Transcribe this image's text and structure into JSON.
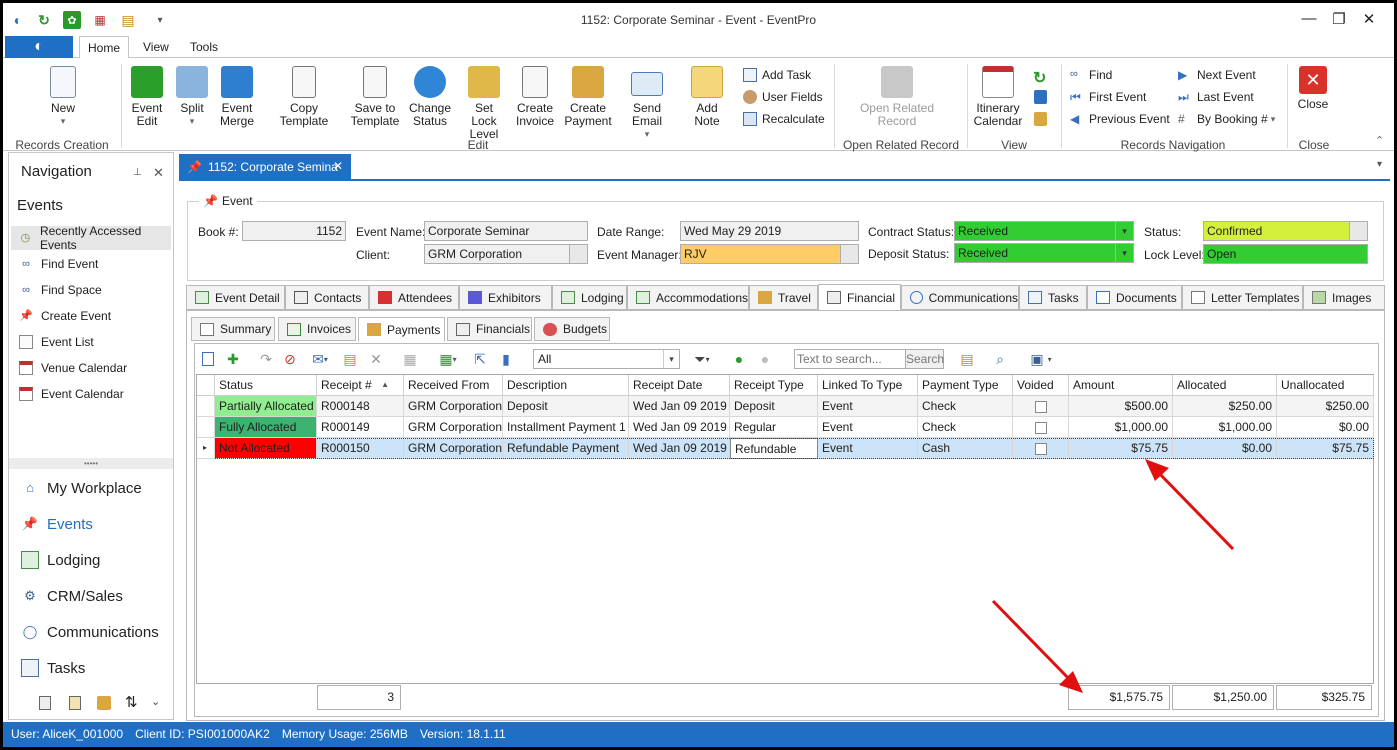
{
  "window": {
    "title": "1152: Corporate Seminar - Event - EventPro",
    "minimize": "—",
    "restore": "❐",
    "close": "✕"
  },
  "ribbon_tabs": [
    "Home",
    "View",
    "Tools"
  ],
  "ribbon": {
    "new": "New",
    "records_creation": "Records Creation",
    "event_edit": "Event\nEdit",
    "split": "Split",
    "event_merge": "Event\nMerge",
    "copy_template": "Copy Template",
    "save_to_template": "Save to\nTemplate",
    "change_status": "Change\nStatus",
    "set_lock_level": "Set Lock\nLevel",
    "create_invoice": "Create\nInvoice",
    "create_payment": "Create\nPayment",
    "send_email": "Send Email",
    "add_note": "Add Note",
    "add_task": "Add Task",
    "user_fields": "User Fields",
    "recalculate": "Recalculate",
    "edit_group": "Edit",
    "open_related_record": "Open Related\nRecord",
    "open_related_group": "Open Related Record",
    "itinerary_calendar": "Itinerary\nCalendar",
    "view_group": "View",
    "find": "Find",
    "first_event": "First Event",
    "previous_event": "Previous Event",
    "next_event": "Next Event",
    "last_event": "Last Event",
    "by_booking": "By Booking #",
    "records_nav_group": "Records Navigation",
    "close": "Close",
    "close_group": "Close"
  },
  "nav": {
    "title": "Navigation",
    "section": "Events",
    "items": [
      "Recently Accessed Events",
      "Find Event",
      "Find Space",
      "Create Event",
      "Event List",
      "Venue Calendar",
      "Event Calendar"
    ],
    "modules": [
      "My Workplace",
      "Events",
      "Lodging",
      "CRM/Sales",
      "Communications",
      "Tasks"
    ],
    "grip": "•••••"
  },
  "doc_tab": "1152: Corporate Semina",
  "event": {
    "header": "Event",
    "book_label": "Book #:",
    "book_value": "1152",
    "name_label": "Event Name:",
    "name_value": "Corporate Seminar",
    "client_label": "Client:",
    "client_value": "GRM Corporation",
    "date_label": "Date Range:",
    "date_value": "Wed May 29 2019",
    "manager_label": "Event Manager:",
    "manager_value": "RJV",
    "contract_label": "Contract Status:",
    "contract_value": "Received",
    "deposit_label": "Deposit Status:",
    "deposit_value": "Received",
    "status_label": "Status:",
    "status_value": "Confirmed",
    "lock_label": "Lock Level:",
    "lock_value": "Open"
  },
  "tabs": [
    "Event Detail",
    "Contacts",
    "Attendees",
    "Exhibitors",
    "Lodging",
    "Accommodations",
    "Travel",
    "Financial",
    "Communications",
    "Tasks",
    "Documents",
    "Letter Templates",
    "Images"
  ],
  "subtabs": [
    "Summary",
    "Invoices",
    "Payments",
    "Financials",
    "Budgets"
  ],
  "toolbar": {
    "filter_value": "All",
    "search_placeholder": "Text to search...",
    "search_button": "Search"
  },
  "grid": {
    "columns": [
      "Status",
      "Receipt #",
      "Received From",
      "Description",
      "Receipt Date",
      "Receipt Type",
      "Linked To Type",
      "Payment Type",
      "Voided",
      "Amount",
      "Allocated",
      "Unallocated"
    ],
    "rows": [
      {
        "status": "Partially Allocated",
        "receipt": "R000148",
        "from": "GRM Corporation",
        "description": "Deposit",
        "date": "Wed Jan 09 2019",
        "type": "Deposit",
        "linked": "Event",
        "payment": "Check",
        "amount": "$500.00",
        "allocated": "$250.00",
        "unallocated": "$250.00"
      },
      {
        "status": "Fully Allocated",
        "receipt": "R000149",
        "from": "GRM Corporation",
        "description": "Installment Payment 1",
        "date": "Wed Jan 09 2019",
        "type": "Regular",
        "linked": "Event",
        "payment": "Check",
        "amount": "$1,000.00",
        "allocated": "$1,000.00",
        "unallocated": "$0.00"
      },
      {
        "status": "Not Allocated",
        "receipt": "R000150",
        "from": "GRM Corporation",
        "description": "Refundable Payment",
        "date": "Wed Jan 09 2019",
        "type": "Refundable",
        "linked": "Event",
        "payment": "Cash",
        "amount": "$75.75",
        "allocated": "$0.00",
        "unallocated": "$75.75"
      }
    ],
    "footer": {
      "count": "3",
      "amount": "$1,575.75",
      "allocated": "$1,250.00",
      "unallocated": "$325.75"
    }
  },
  "statusbar": {
    "user": "User: AliceK_001000",
    "client": "Client ID: PSI001000AK2",
    "memory": "Memory Usage: 256MB",
    "version": "Version: 18.1.11"
  },
  "colors": {
    "accent": "#1f6fc5",
    "partially": "#90ee90",
    "fully": "#3cb371",
    "not": "#ff0000",
    "received": "#32cd32",
    "confirmed": "#d4f03c",
    "manager": "#ffcc66",
    "selected_row": "#cde3f7",
    "arrow": "#e01010"
  }
}
